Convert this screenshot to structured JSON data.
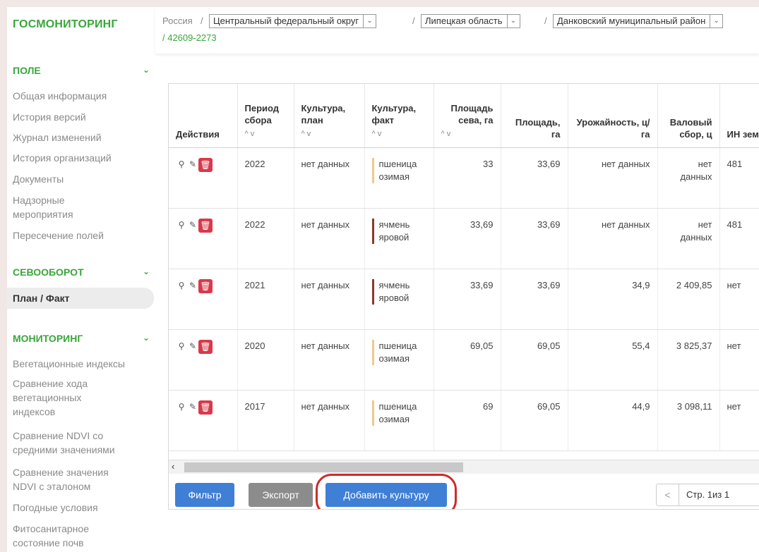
{
  "app": {
    "logo": "ГОСМОНИТОРИНГ"
  },
  "sidebar": {
    "section_pole": "ПОЛЕ",
    "pole_items": [
      "Общая информация",
      "История версий",
      "Журнал изменений",
      "История организаций",
      "Документы",
      "Надзорные мероприятия",
      "Пересечение полей"
    ],
    "section_sevo": "СЕВООБОРОТ",
    "sevo_active": "План / Факт",
    "section_monitoring": "МОНИТОРИНГ",
    "monitoring_items": [
      "Вегетационные индексы",
      "Сравнение хода вегетационных индексов",
      "Сравнение NDVI со средними значениями",
      "Сравнение значения NDVI с эталоном",
      "Погодные условия",
      "Фитосанитарное состояние почв"
    ]
  },
  "breadcrumb": {
    "root": "Россия",
    "sep": "/",
    "district": "Центральный федеральный округ",
    "region": "Липецкая область",
    "municipality": "Данковский муниципальный район",
    "field_id": "/ 42609-2273"
  },
  "table": {
    "headers": {
      "actions": "Действия",
      "period": "Период сбора",
      "crop_plan": "Культура, план",
      "crop_fact": "Культура, факт",
      "sown_area": "Площадь сева, га",
      "area": "Площадь, га",
      "yield": "Урожайность, ц/га",
      "gross": "Валовый сбор, ц",
      "inn": "ИН зем"
    },
    "sort_glyph": "^ v",
    "rows": [
      {
        "period": "2022",
        "crop_plan": "нет данных",
        "crop_fact": "пшеница озимая",
        "crop_color": "#f0c890",
        "sown_area": "33",
        "area": "33,69",
        "yield": "нет данных",
        "gross": "нет данных",
        "inn": "481"
      },
      {
        "period": "2022",
        "crop_plan": "нет данных",
        "crop_fact": "ячмень яровой",
        "crop_color": "#8b3a2a",
        "sown_area": "33,69",
        "area": "33,69",
        "yield": "нет данных",
        "gross": "нет данных",
        "inn": "481"
      },
      {
        "period": "2021",
        "crop_plan": "нет данных",
        "crop_fact": "ячмень яровой",
        "crop_color": "#8b3a2a",
        "sown_area": "33,69",
        "area": "33,69",
        "yield": "34,9",
        "gross": "2 409,85",
        "inn": "нет"
      },
      {
        "period": "2020",
        "crop_plan": "нет данных",
        "crop_fact": "пшеница озимая",
        "crop_color": "#f0c890",
        "sown_area": "69,05",
        "area": "69,05",
        "yield": "55,4",
        "gross": "3 825,37",
        "inn": "нет"
      },
      {
        "period": "2017",
        "crop_plan": "нет данных",
        "crop_fact": "пшеница озимая",
        "crop_color": "#f0c890",
        "sown_area": "69",
        "area": "69,05",
        "yield": "44,9",
        "gross": "3 098,11",
        "inn": "нет"
      }
    ]
  },
  "footer": {
    "filter_label": "Фильтр",
    "export_label": "Экспорт",
    "add_crop_label": "Добавить культуру",
    "page_text": "Стр. 1из 1",
    "prev_glyph": "<"
  },
  "colors": {
    "brand_green": "#3aa63a",
    "primary_blue": "#3f7fd6",
    "delete_red": "#d9394b",
    "highlight_red": "#d02a2a"
  }
}
